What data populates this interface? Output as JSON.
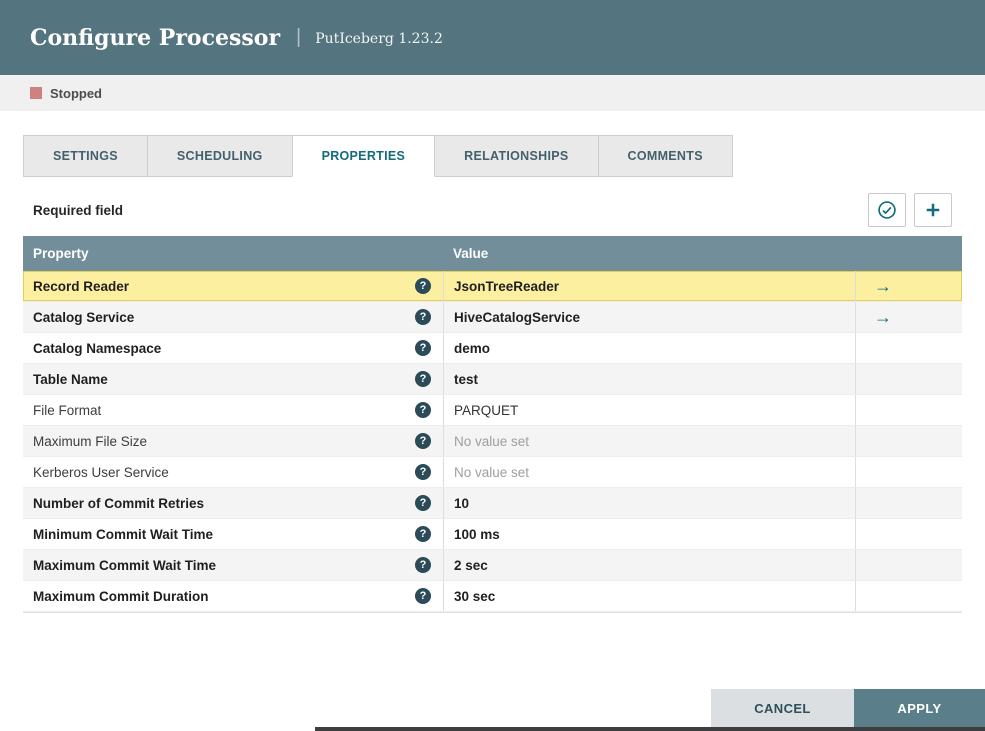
{
  "colors": {
    "header_bg": "#54747f",
    "accent": "#136c7d",
    "table_header_bg": "#728e9b",
    "selected_row_bg": "#fcf0a0",
    "stopped_indicator": "#d0807e",
    "apply_button_bg": "#5a7f8b"
  },
  "header": {
    "title": "Configure Processor",
    "separator": "|",
    "subtitle": "PutIceberg 1.23.2"
  },
  "status": {
    "label": "Stopped"
  },
  "tabs": {
    "active": "PROPERTIES",
    "items": [
      {
        "label": "SETTINGS"
      },
      {
        "label": "SCHEDULING"
      },
      {
        "label": "PROPERTIES"
      },
      {
        "label": "RELATIONSHIPS"
      },
      {
        "label": "COMMENTS"
      }
    ]
  },
  "properties_panel": {
    "required_field_label": "Required field",
    "verify_button_icon": "checkmark-circle-icon",
    "add_button_icon": "plus-icon",
    "help_icon_glyph": "?",
    "goto_icon_glyph": "→",
    "table": {
      "columns": {
        "property": "Property",
        "value": "Value"
      },
      "rows": [
        {
          "property": "Record Reader",
          "required": true,
          "value": "JsonTreeReader",
          "value_set": true,
          "has_goto": true,
          "selected": true
        },
        {
          "property": "Catalog Service",
          "required": true,
          "value": "HiveCatalogService",
          "value_set": true,
          "has_goto": true,
          "selected": false
        },
        {
          "property": "Catalog Namespace",
          "required": true,
          "value": "demo",
          "value_set": true,
          "has_goto": false,
          "selected": false
        },
        {
          "property": "Table Name",
          "required": true,
          "value": "test",
          "value_set": true,
          "has_goto": false,
          "selected": false
        },
        {
          "property": "File Format",
          "required": false,
          "value": "PARQUET",
          "value_set": true,
          "has_goto": false,
          "selected": false
        },
        {
          "property": "Maximum File Size",
          "required": false,
          "value": "No value set",
          "value_set": false,
          "has_goto": false,
          "selected": false
        },
        {
          "property": "Kerberos User Service",
          "required": false,
          "value": "No value set",
          "value_set": false,
          "has_goto": false,
          "selected": false
        },
        {
          "property": "Number of Commit Retries",
          "required": true,
          "value": "10",
          "value_set": true,
          "has_goto": false,
          "selected": false
        },
        {
          "property": "Minimum Commit Wait Time",
          "required": true,
          "value": "100 ms",
          "value_set": true,
          "has_goto": false,
          "selected": false
        },
        {
          "property": "Maximum Commit Wait Time",
          "required": true,
          "value": "2 sec",
          "value_set": true,
          "has_goto": false,
          "selected": false
        },
        {
          "property": "Maximum Commit Duration",
          "required": true,
          "value": "30 sec",
          "value_set": true,
          "has_goto": false,
          "selected": false
        }
      ]
    }
  },
  "footer": {
    "cancel_label": "CANCEL",
    "apply_label": "APPLY"
  }
}
